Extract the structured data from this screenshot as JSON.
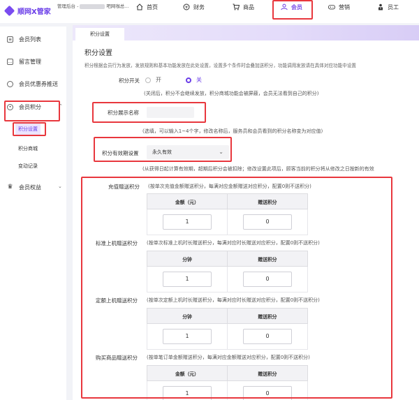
{
  "header": {
    "logo_text": "顺网X管家",
    "subtitle_prefix": "管理后台 -",
    "subtitle_suffix": "吧网咖总...",
    "nav": [
      {
        "label": "首页",
        "icon": "home-icon"
      },
      {
        "label": "财务",
        "icon": "finance-icon"
      },
      {
        "label": "商品",
        "icon": "cart-icon"
      },
      {
        "label": "会员",
        "icon": "member-icon",
        "active": true
      },
      {
        "label": "营销",
        "icon": "gamepad-icon"
      },
      {
        "label": "员工",
        "icon": "staff-icon"
      }
    ]
  },
  "sidebar": {
    "items": [
      {
        "label": "会员列表"
      },
      {
        "label": "留言管理"
      },
      {
        "label": "会员优惠券推送"
      },
      {
        "label": "会员积分",
        "expanded": true
      },
      {
        "label": "会员权益"
      }
    ],
    "sub_items": [
      {
        "label": "积分设置",
        "active": true
      },
      {
        "label": "积分商城"
      },
      {
        "label": "变动记录"
      }
    ]
  },
  "main": {
    "tab": "积分设置",
    "title": "积分设置",
    "description": "积分根据会员行为发放，发放规则和基本功能发放在此处设置，设置多个条件时会叠加送积分，功能调用发放请在具体对应功能中设置",
    "switch": {
      "label": "积分开关",
      "on_label": "开",
      "off_label": "关",
      "selected": "关",
      "hint": "(关闭后，积分不会继续发放，积分商城功能会被屏蔽，会员无法看到自己的积分)"
    },
    "display_name": {
      "label": "积分展示名称",
      "value": "",
      "hint": "(选填，可以输入1~4个字，修改名称后，服务员和会员看到的积分名称变为对应值)"
    },
    "validity": {
      "label": "积分有效期设置",
      "value": "永久有效",
      "hint": "(从获得日起计算有效期，超期后积分会被扣除；修改设置此项后，顾客当前的积分将从修改之日按新的有效"
    },
    "rules": [
      {
        "label": "充值赠送积分",
        "hint": "(按单次充值金额赠送积分，每满对应金额赠送对应积分，配置0则不送积分)",
        "col1": "金额（元）",
        "col2": "赠送积分",
        "val1": "1",
        "val2": "0"
      },
      {
        "label": "标准上机赠送积分",
        "hint": "(按单次标准上机时长赠送积分，每满对应时长赠送对应积分，配置0则不送积分)",
        "col1": "分钟",
        "col2": "赠送积分",
        "val1": "1",
        "val2": "0"
      },
      {
        "label": "定额上机赠送积分",
        "hint": "(按单次定额上机时长赠送积分，每满对应时长赠送对应积分，配置0则不送积分)",
        "col1": "分钟",
        "col2": "赠送积分",
        "val1": "1",
        "val2": "0"
      },
      {
        "label": "购买商品赠送积分",
        "hint": "(按单笔订单金额赠送积分，每满对应金额赠送对应积分，配置0则不送积分)",
        "col1": "金额（元）",
        "col2": "赠送积分",
        "val1": "1",
        "val2": "0"
      }
    ]
  },
  "colors": {
    "accent": "#6a3de8",
    "highlight": "#e8373d"
  }
}
